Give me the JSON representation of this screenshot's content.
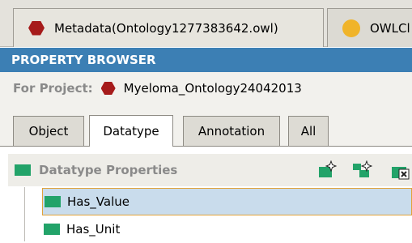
{
  "file_tabs": [
    {
      "label": "Metadata(Ontology1277383642.owl)",
      "icon": "red-hexagon"
    },
    {
      "label": "OWLCl",
      "icon": "orange-circle"
    }
  ],
  "panel": {
    "title": "PROPERTY BROWSER"
  },
  "project": {
    "label": "For Project:",
    "value": "Myeloma_Ontology24042013"
  },
  "tabs": [
    {
      "label": "Object",
      "active": false
    },
    {
      "label": "Datatype",
      "active": true
    },
    {
      "label": "Annotation",
      "active": false
    },
    {
      "label": "All",
      "active": false
    }
  ],
  "section": {
    "title": "Datatype Properties"
  },
  "properties": [
    {
      "label": "Has_Value",
      "selected": true
    },
    {
      "label": "Has_Unit",
      "selected": false
    }
  ],
  "colors": {
    "banner": "#3c7fb4",
    "property_icon": "#22a369",
    "project_icon": "#a61b1b",
    "selection": "#c9dcec"
  }
}
